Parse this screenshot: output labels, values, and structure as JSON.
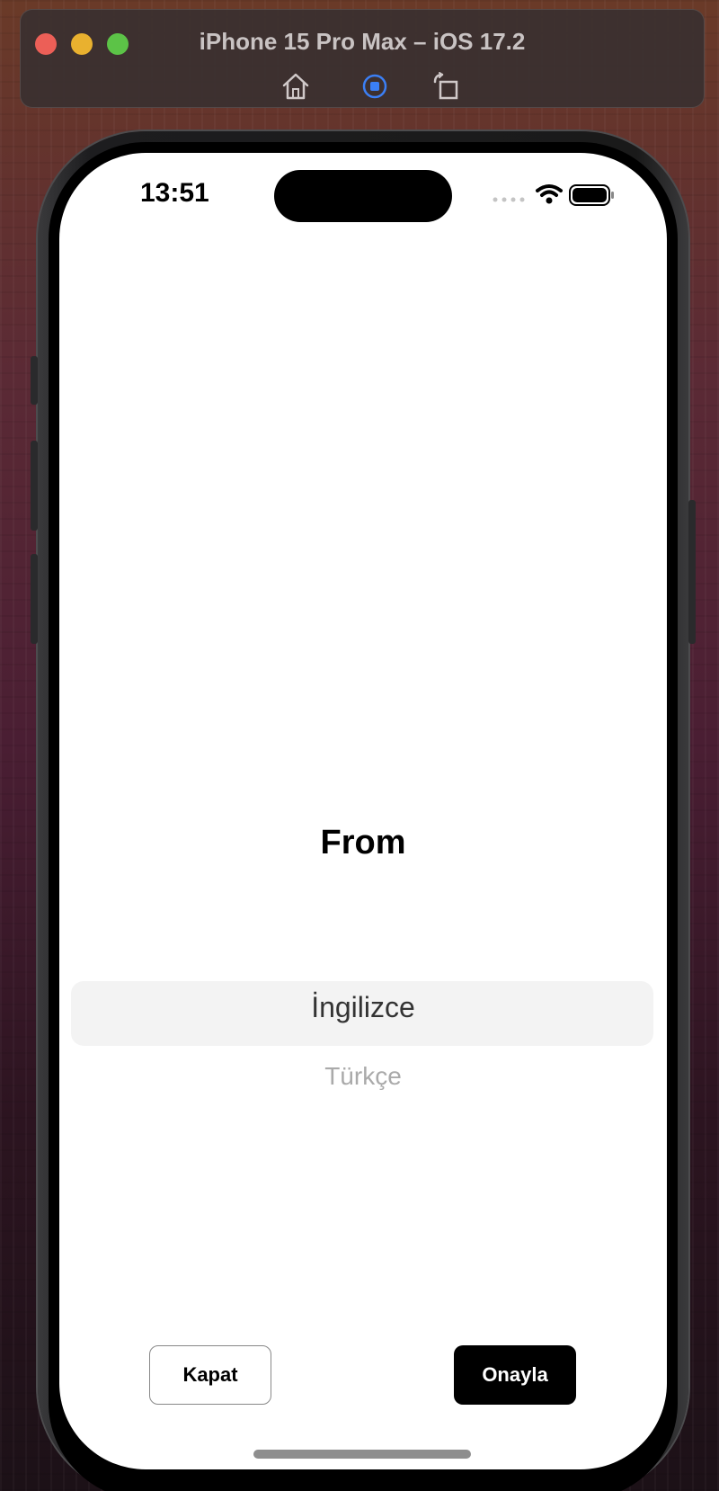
{
  "simulator": {
    "title": "iPhone 15 Pro Max – iOS 17.2",
    "toolbar": {
      "home_icon": "home-icon",
      "screenshot_icon": "record-icon",
      "rotate_icon": "rotate-icon"
    },
    "traffic_colors": [
      "#ec5f57",
      "#e9b12f",
      "#5cc347"
    ]
  },
  "status_bar": {
    "time": "13:51",
    "icons": [
      "cellular-icon",
      "wifi-icon",
      "battery-icon"
    ]
  },
  "picker_sheet": {
    "title": "From",
    "options": [
      {
        "label": "İngilizce",
        "selected": true
      },
      {
        "label": "Türkçe",
        "selected": false
      }
    ],
    "close_label": "Kapat",
    "confirm_label": "Onayla"
  },
  "colors": {
    "confirm_bg": "#000000",
    "highlight_bg": "#f3f3f3",
    "record_accent": "#3b7ff5"
  }
}
